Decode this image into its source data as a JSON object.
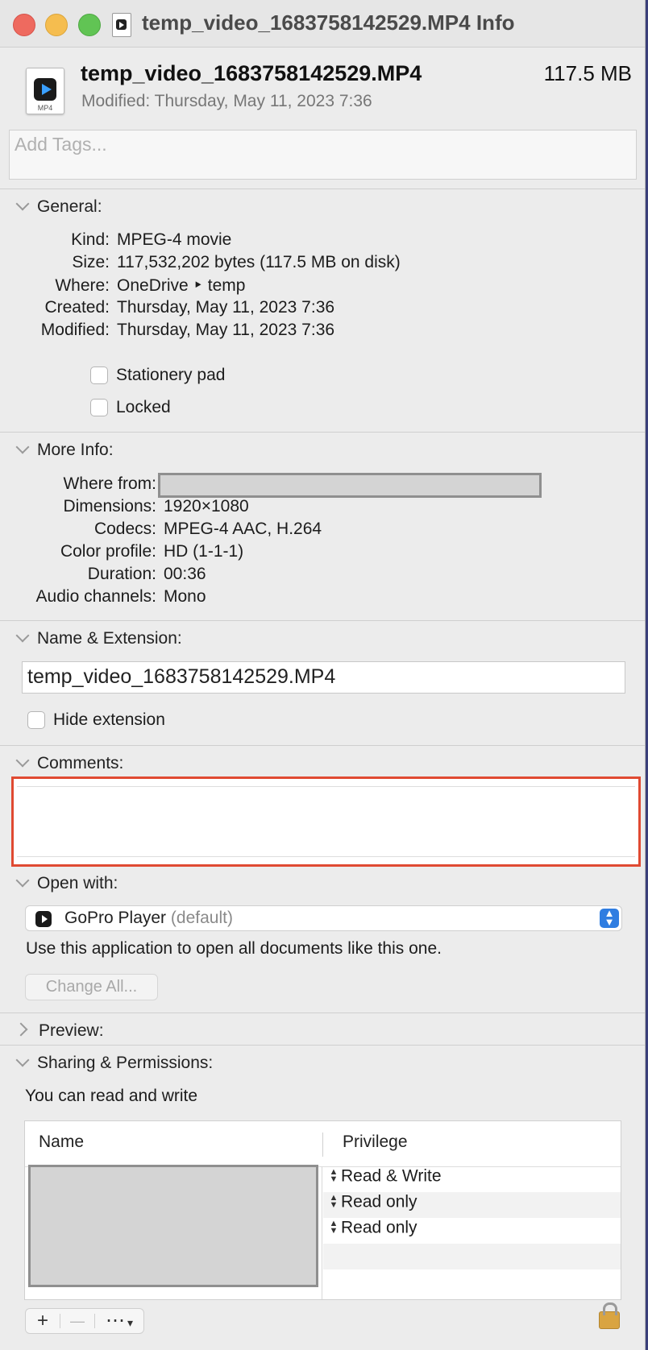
{
  "window": {
    "title": "temp_video_1683758142529.MP4 Info"
  },
  "file": {
    "name": "temp_video_1683758142529.MP4",
    "size": "117.5 MB",
    "modified_line": "Modified: Thursday, May 11, 2023 7:36",
    "icon_ext": "MP4"
  },
  "tags": {
    "placeholder": "Add Tags..."
  },
  "general": {
    "header": "General:",
    "rows": [
      {
        "key": "Kind:",
        "value": "MPEG-4 movie"
      },
      {
        "key": "Size:",
        "value": "117,532,202 bytes (117.5 MB on disk)"
      },
      {
        "key": "Where:",
        "value": "OneDrive ‣ temp"
      },
      {
        "key": "Created:",
        "value": "Thursday, May 11, 2023 7:36"
      },
      {
        "key": "Modified:",
        "value": "Thursday, May 11, 2023 7:36"
      }
    ],
    "stationery_label": "Stationery pad",
    "locked_label": "Locked"
  },
  "more_info": {
    "header": "More Info:",
    "rows": [
      {
        "key": "Where from:",
        "value": ""
      },
      {
        "key": "Dimensions:",
        "value": "1920×1080"
      },
      {
        "key": "Codecs:",
        "value": "MPEG-4 AAC, H.264"
      },
      {
        "key": "Color profile:",
        "value": "HD (1-1-1)"
      },
      {
        "key": "Duration:",
        "value": "00:36"
      },
      {
        "key": "Audio channels:",
        "value": "Mono"
      }
    ]
  },
  "name_extension": {
    "header": "Name & Extension:",
    "value": "temp_video_1683758142529.MP4",
    "hide_extension_label": "Hide extension"
  },
  "comments": {
    "header": "Comments:",
    "value": ""
  },
  "open_with": {
    "header": "Open with:",
    "app": "GoPro Player",
    "default_label": "(default)",
    "description": "Use this application to open all documents like this one.",
    "change_all_label": "Change All..."
  },
  "preview": {
    "header": "Preview:"
  },
  "sharing": {
    "header": "Sharing & Permissions:",
    "summary": "You can read and write",
    "col_name": "Name",
    "col_privilege": "Privilege",
    "privileges": [
      "Read & Write",
      "Read only",
      "Read only"
    ]
  },
  "toolbar": {
    "add": "+",
    "remove": "—",
    "action": "⋯"
  },
  "colors": {
    "highlight": "#e04a32",
    "accent": "#2f7de1"
  }
}
